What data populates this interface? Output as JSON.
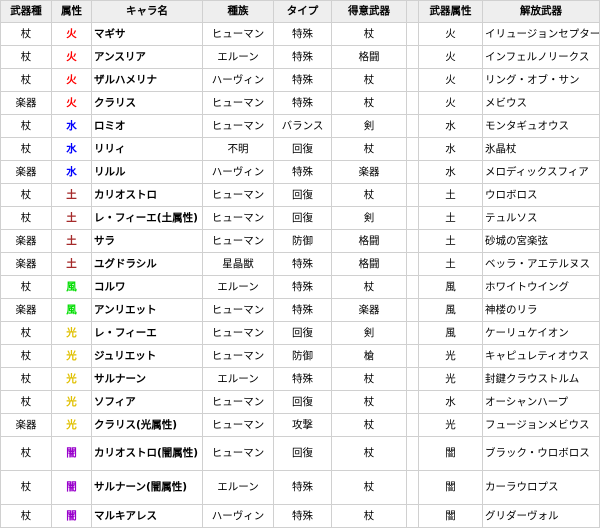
{
  "headers": [
    "武器種",
    "属性",
    "キャラ名",
    "種族",
    "タイプ",
    "得意武器",
    "",
    "武器属性",
    "解放武器"
  ],
  "element_colors": {
    "火": "#ff0000",
    "水": "#0000ff",
    "土": "#a52a2a",
    "風": "#00dd00",
    "光": "#e0c000",
    "闇": "#9900cc"
  },
  "rows": [
    {
      "weapon_type": "杖",
      "element": "火",
      "name": "マギサ",
      "race": "ヒューマン",
      "type": "特殊",
      "fav_weapon": "杖",
      "weapon_element": "火",
      "unlock_weapon": "イリュージョンセプター"
    },
    {
      "weapon_type": "杖",
      "element": "火",
      "name": "アンスリア",
      "race": "エルーン",
      "type": "特殊",
      "fav_weapon": "格闘",
      "weapon_element": "火",
      "unlock_weapon": "インフェルノリークス"
    },
    {
      "weapon_type": "杖",
      "element": "火",
      "name": "ザルハメリナ",
      "race": "ハーヴィン",
      "type": "特殊",
      "fav_weapon": "杖",
      "weapon_element": "火",
      "unlock_weapon": "リング・オブ・サン"
    },
    {
      "weapon_type": "楽器",
      "element": "火",
      "name": "クラリス",
      "race": "ヒューマン",
      "type": "特殊",
      "fav_weapon": "杖",
      "weapon_element": "火",
      "unlock_weapon": "メビウス"
    },
    {
      "weapon_type": "杖",
      "element": "水",
      "name": "ロミオ",
      "race": "ヒューマン",
      "type": "バランス",
      "fav_weapon": "剣",
      "weapon_element": "水",
      "unlock_weapon": "モンタギュオウス"
    },
    {
      "weapon_type": "杖",
      "element": "水",
      "name": "リリィ",
      "race": "不明",
      "type": "回復",
      "fav_weapon": "杖",
      "weapon_element": "水",
      "unlock_weapon": "氷晶杖"
    },
    {
      "weapon_type": "楽器",
      "element": "水",
      "name": "リルル",
      "race": "ハーヴィン",
      "type": "特殊",
      "fav_weapon": "楽器",
      "weapon_element": "水",
      "unlock_weapon": "メロディックスフィア"
    },
    {
      "weapon_type": "杖",
      "element": "土",
      "name": "カリオストロ",
      "race": "ヒューマン",
      "type": "回復",
      "fav_weapon": "杖",
      "weapon_element": "土",
      "unlock_weapon": "ウロボロス"
    },
    {
      "weapon_type": "杖",
      "element": "土",
      "name": "レ・フィーエ(土属性)",
      "race": "ヒューマン",
      "type": "回復",
      "fav_weapon": "剣",
      "weapon_element": "土",
      "unlock_weapon": "テュルソス"
    },
    {
      "weapon_type": "楽器",
      "element": "土",
      "name": "サラ",
      "race": "ヒューマン",
      "type": "防御",
      "fav_weapon": "格闘",
      "weapon_element": "土",
      "unlock_weapon": "砂城の宮楽弦"
    },
    {
      "weapon_type": "楽器",
      "element": "土",
      "name": "ユグドラシル",
      "race": "星晶獣",
      "type": "特殊",
      "fav_weapon": "格闘",
      "weapon_element": "土",
      "unlock_weapon": "ベッラ・アエテルヌス"
    },
    {
      "weapon_type": "杖",
      "element": "風",
      "name": "コルワ",
      "race": "エルーン",
      "type": "特殊",
      "fav_weapon": "杖",
      "weapon_element": "風",
      "unlock_weapon": "ホワイトウイング"
    },
    {
      "weapon_type": "楽器",
      "element": "風",
      "name": "アンリエット",
      "race": "ヒューマン",
      "type": "特殊",
      "fav_weapon": "楽器",
      "weapon_element": "風",
      "unlock_weapon": "神楼のリラ"
    },
    {
      "weapon_type": "杖",
      "element": "光",
      "name": "レ・フィーエ",
      "race": "ヒューマン",
      "type": "回復",
      "fav_weapon": "剣",
      "weapon_element": "風",
      "unlock_weapon": "ケーリュケイオン"
    },
    {
      "weapon_type": "杖",
      "element": "光",
      "name": "ジュリエット",
      "race": "ヒューマン",
      "type": "防御",
      "fav_weapon": "槍",
      "weapon_element": "光",
      "unlock_weapon": "キャピュレティオウス"
    },
    {
      "weapon_type": "杖",
      "element": "光",
      "name": "サルナーン",
      "race": "エルーン",
      "type": "特殊",
      "fav_weapon": "杖",
      "weapon_element": "光",
      "unlock_weapon": "封鍵クラウストルム"
    },
    {
      "weapon_type": "杖",
      "element": "光",
      "name": "ソフィア",
      "race": "ヒューマン",
      "type": "回復",
      "fav_weapon": "杖",
      "weapon_element": "水",
      "unlock_weapon": "オーシャンハープ"
    },
    {
      "weapon_type": "楽器",
      "element": "光",
      "name": "クラリス(光属性)",
      "race": "ヒューマン",
      "type": "攻撃",
      "fav_weapon": "杖",
      "weapon_element": "光",
      "unlock_weapon": "フュージョンメビウス"
    },
    {
      "weapon_type": "杖",
      "element": "闇",
      "name": "カリオストロ(闇属性)",
      "race": "ヒューマン",
      "type": "回復",
      "fav_weapon": "杖",
      "weapon_element": "闇",
      "unlock_weapon": "ブラック・ウロボロス"
    },
    {
      "weapon_type": "杖",
      "element": "闇",
      "name": "サルナーン(闇属性)",
      "race": "エルーン",
      "type": "特殊",
      "fav_weapon": "杖",
      "weapon_element": "闇",
      "unlock_weapon": "カーラウロプス"
    },
    {
      "weapon_type": "杖",
      "element": "闇",
      "name": "マルキアレス",
      "race": "ハーヴィン",
      "type": "特殊",
      "fav_weapon": "杖",
      "weapon_element": "闇",
      "unlock_weapon": "グリダーヴォル"
    }
  ]
}
